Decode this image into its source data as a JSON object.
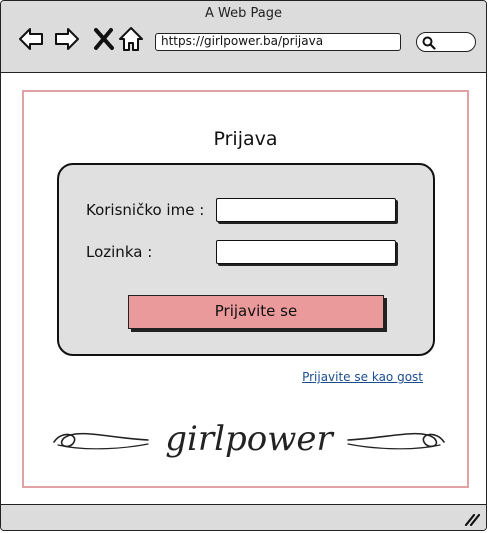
{
  "window": {
    "title": "A Web Page"
  },
  "toolbar": {
    "back_icon": "arrow-left-icon",
    "forward_icon": "arrow-right-icon",
    "close_icon": "close-icon",
    "home_icon": "home-icon",
    "url": "https://girlpower.ba/prijava",
    "search_icon": "search-icon"
  },
  "page": {
    "title": "Prijava",
    "form": {
      "username_label": "Korisničko ime :",
      "username_value": "",
      "password_label": "Lozinka :",
      "password_value": "",
      "submit_label": "Prijavite se"
    },
    "guest_link": "Prijavite se kao gost",
    "logo_text": "girlpower"
  },
  "colors": {
    "accent_border": "#e0a3a3",
    "button_fill": "#ea9a9a",
    "link": "#1a4d8f",
    "chrome": "#dcdcdc"
  }
}
